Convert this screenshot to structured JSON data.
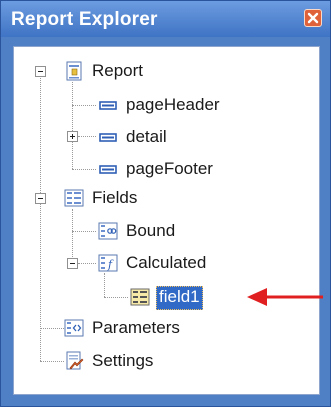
{
  "window": {
    "title": "Report Explorer"
  },
  "tree": {
    "report": "Report",
    "page_header": "pageHeader",
    "detail": "detail",
    "page_footer": "pageFooter",
    "fields": "Fields",
    "bound": "Bound",
    "calculated": "Calculated",
    "field1": "field1",
    "parameters": "Parameters",
    "settings": "Settings"
  },
  "colors": {
    "titlebar": "#4f7fc4",
    "selection": "#3169c6",
    "arrow": "#e02020"
  },
  "icons": {
    "close": "close-icon",
    "report": "report-icon",
    "section": "section-icon",
    "fields": "fields-icon",
    "bound": "bound-field-icon",
    "calculated": "calculated-field-icon",
    "field": "field-icon",
    "parameters": "parameters-icon",
    "settings": "settings-icon",
    "callout": "red-arrow-icon"
  }
}
